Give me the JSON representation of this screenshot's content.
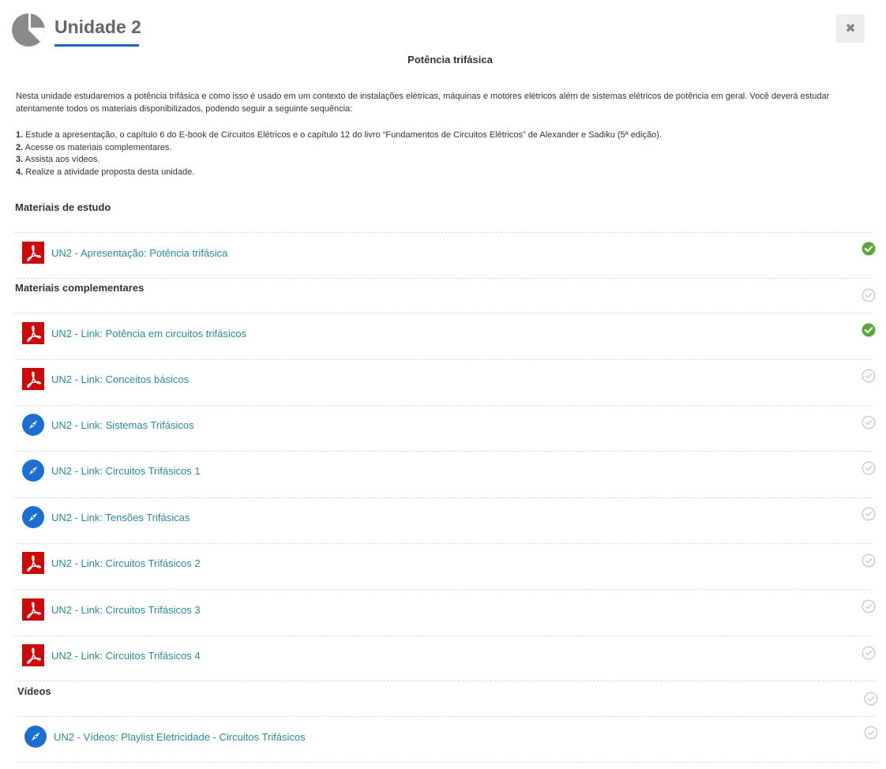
{
  "header": {
    "title": "Unidade 2",
    "subtitle": "Potência trifásica",
    "close_glyph": "✖",
    "accent_color": "#1a66c6"
  },
  "intro": {
    "paragraph": "Nesta unidade estudaremos a potência trifásica e como isso é usado em um contexto de instalações elétricas, máquinas e motores elétricos além de sistemas elétricos de potência em geral. Você deverá estudar atentamente todos os materiais disponibilizados, podendo seguir a seguinte sequência:",
    "steps": [
      {
        "num": "1.",
        "text": " Estude a apresentação, o capítulo 6 do E-book de Circuitos Elétricos e o capítulo 12 do livro “Fundamentos de Circuitos Elétricos” de Alexander e Sadiku (5ª edição)."
      },
      {
        "num": "2.",
        "text": " Acesse os materiais complementares."
      },
      {
        "num": "3.",
        "text": " Assista aos vídeos."
      },
      {
        "num": "4.",
        "text": " Realize a atividade proposta desta unidade."
      }
    ]
  },
  "sections": {
    "study": "Materiais de estudo",
    "complementary": "Materiais complementares",
    "videos": "Vídeos"
  },
  "items": [
    {
      "label": "UN2 - Apresentação: Potência trifásica",
      "icon": "pdf-icon",
      "completed": true
    },
    {
      "label": "UN2 - Link: Potência em circuitos trifásicos",
      "icon": "pdf-icon",
      "completed": true
    },
    {
      "label": "UN2 - Link: Conceitos básicos",
      "icon": "pdf-icon",
      "completed": false
    },
    {
      "label": "UN2 - Link: Sistemas Trifásicos",
      "icon": "compass-icon",
      "completed": false
    },
    {
      "label": "UN2 - Link: Circuitos Trifásicos 1",
      "icon": "compass-icon",
      "completed": false
    },
    {
      "label": "UN2 - Link: Tensões Trifásicas",
      "icon": "compass-icon",
      "completed": false
    },
    {
      "label": "UN2 - Link: Circuitos Trifásicos 2",
      "icon": "pdf-icon",
      "completed": false
    },
    {
      "label": "UN2 - Link: Circuitos Trifásicos 3",
      "icon": "pdf-icon",
      "completed": false
    },
    {
      "label": "UN2 - Link: Circuitos Trifásicos 4",
      "icon": "pdf-icon",
      "completed": false
    },
    {
      "label": "UN2 - Vídeos: Playlist Eletricidade - Circuitos Trifásicos",
      "icon": "compass-icon",
      "completed": false
    }
  ],
  "colors": {
    "link": "#2b8a98",
    "pdf": "#cc0a0a",
    "compass": "#1b6fd0",
    "done": "#5aa837",
    "pending": "#cccccc"
  }
}
